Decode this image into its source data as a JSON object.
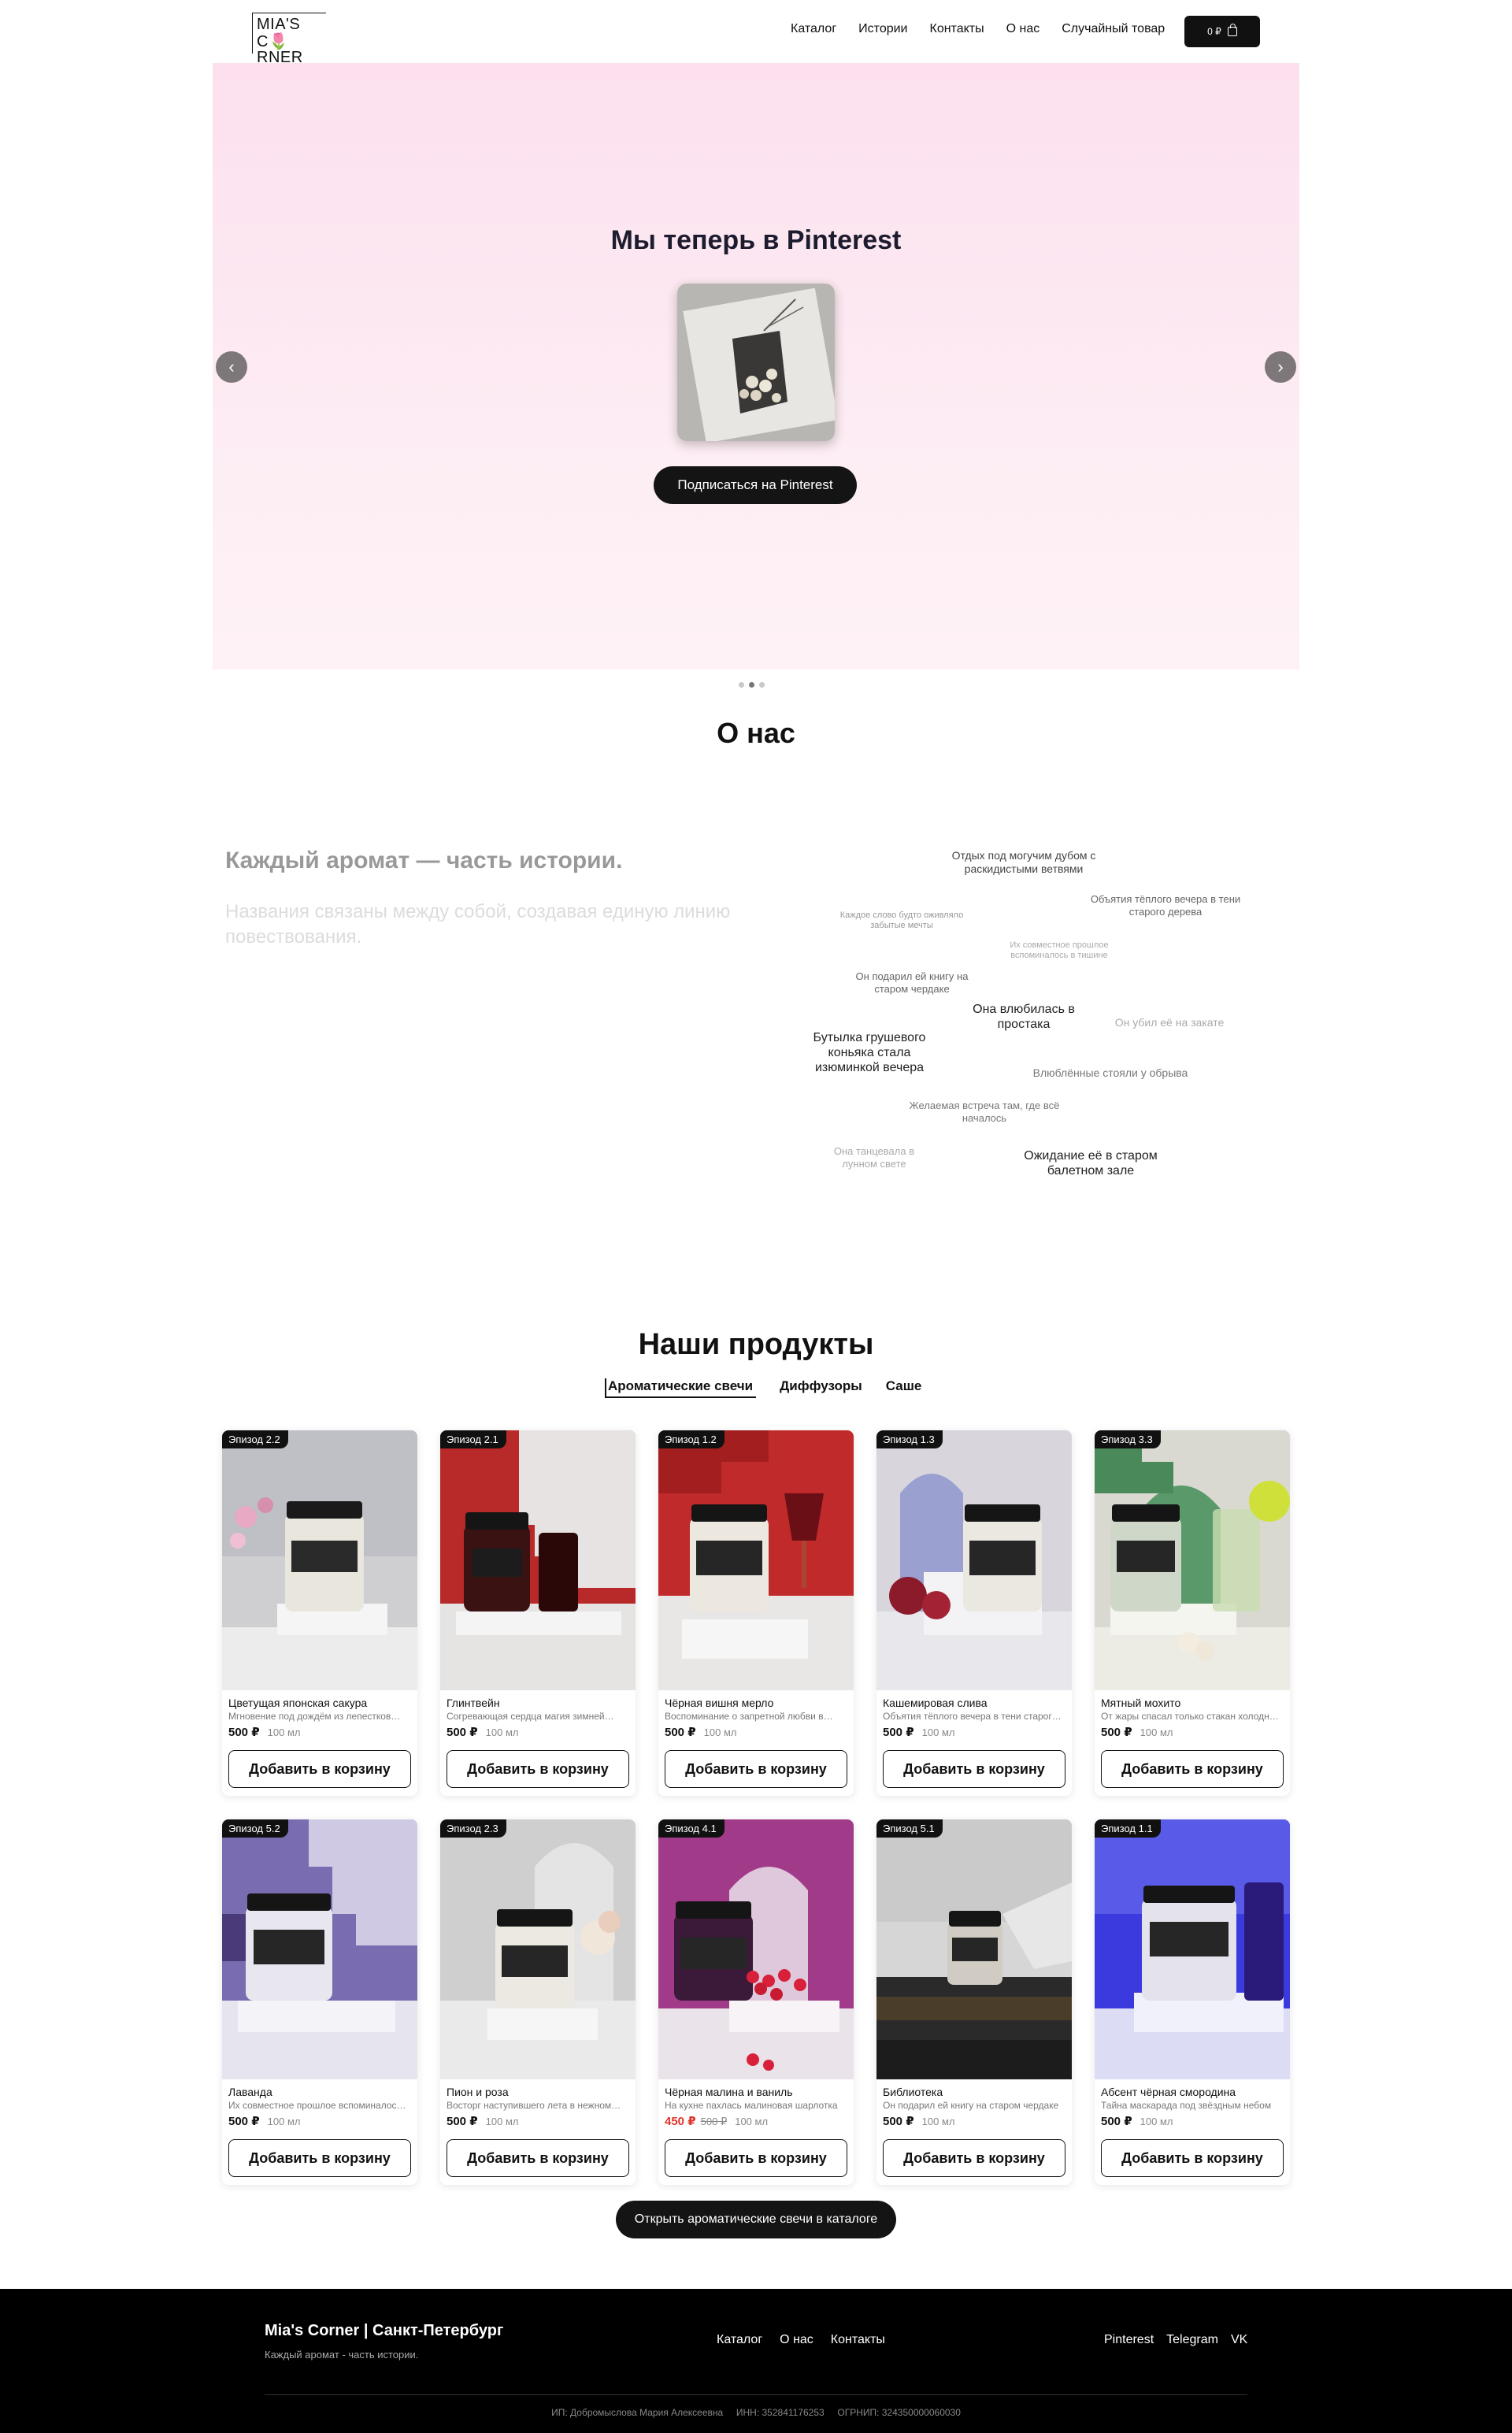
{
  "header": {
    "logo_line1": "MIA'S",
    "logo_line2": "C🌷RNER",
    "nav": [
      "Каталог",
      "Истории",
      "Контакты",
      "О нас",
      "Случайный товар"
    ],
    "cart_total": "0 ₽"
  },
  "hero": {
    "title": "Мы теперь в Pinterest",
    "cta": "Подписаться на Pinterest",
    "prev_icon": "‹",
    "next_icon": "›",
    "slides": 3,
    "active_slide": 2
  },
  "about": {
    "title": "О нас",
    "headline": "Каждый аромат — часть истории.",
    "subline": "Названия связаны между собой, создавая единую линию повествования.",
    "cloud": [
      "Отдых под могучим дубом с раскидистыми ветвями",
      "Объятия тёплого вечера в тени старого дерева",
      "Каждое слово будто оживляло забытые мечты",
      "Их совместное прошлое вспоминалось в тишине",
      "Он подарил ей книгу на старом чердаке",
      "Она влюбилась в простака",
      "Он убил её на закате",
      "Бутылка грушевого коньяка стала изюминкой вечера",
      "Влюблённые стояли у обрыва",
      "Желаемая встреча там, где всё началось",
      "Она танцевала в лунном свете",
      "Ожидание её в старом балетном зале"
    ]
  },
  "products": {
    "title": "Наши продукты",
    "tabs": [
      "Ароматические свечи",
      "Диффузоры",
      "Саше"
    ],
    "add_label": "Добавить в корзину",
    "items": [
      {
        "episode": "Эпизод 2.2",
        "name": "Цветущая японская сакура",
        "desc": "Мгновение под дождём из лепестков…",
        "price": "500 ₽",
        "old_price": "",
        "volume": "100 мл"
      },
      {
        "episode": "Эпизод 2.1",
        "name": "Глинтвейн",
        "desc": "Согревающая сердца магия зимней…",
        "price": "500 ₽",
        "old_price": "",
        "volume": "100 мл"
      },
      {
        "episode": "Эпизод 1.2",
        "name": "Чёрная вишня мерло",
        "desc": "Воспоминание о запретной любви в…",
        "price": "500 ₽",
        "old_price": "",
        "volume": "100 мл"
      },
      {
        "episode": "Эпизод 1.3",
        "name": "Кашемировая слива",
        "desc": "Объятия тёплого вечера в тени старог…",
        "price": "500 ₽",
        "old_price": "",
        "volume": "100 мл"
      },
      {
        "episode": "Эпизод 3.3",
        "name": "Мятный мохито",
        "desc": "От жары спасал только стакан холодн…",
        "price": "500 ₽",
        "old_price": "",
        "volume": "100 мл"
      },
      {
        "episode": "Эпизод 5.2",
        "name": "Лаванда",
        "desc": "Их совместное прошлое вспоминалос…",
        "price": "500 ₽",
        "old_price": "",
        "volume": "100 мл"
      },
      {
        "episode": "Эпизод 2.3",
        "name": "Пион и роза",
        "desc": "Восторг наступившего лета в нежном…",
        "price": "500 ₽",
        "old_price": "",
        "volume": "100 мл"
      },
      {
        "episode": "Эпизод 4.1",
        "name": "Чёрная малина и ваниль",
        "desc": "На кухне пахлась малиновая шарлотка",
        "price": "450 ₽",
        "old_price": "500 ₽",
        "volume": "100 мл"
      },
      {
        "episode": "Эпизод 5.1",
        "name": "Библиотека",
        "desc": "Он подарил ей книгу на старом чердаке",
        "price": "500 ₽",
        "old_price": "",
        "volume": "100 мл"
      },
      {
        "episode": "Эпизод 1.1",
        "name": "Абсент чёрная смородина",
        "desc": "Тайна маскарада под звёздным небом",
        "price": "500 ₽",
        "old_price": "",
        "volume": "100 мл"
      }
    ],
    "open_catalog": "Открыть ароматические свечи в каталоге"
  },
  "footer": {
    "brand": "Mia's Corner | Санкт-Петербург",
    "tagline": "Каждый аромат - часть истории.",
    "nav": [
      "Каталог",
      "О нас",
      "Контакты"
    ],
    "social": [
      "Pinterest",
      "Telegram",
      "VK"
    ],
    "legal": "ИП: Добромыслова Мария Алексеевна     ИНН: 352841176253     ОГРНИП: 324350000060030"
  },
  "colors": {
    "accent": "#141414",
    "sale": "#e0342a",
    "hero_bg": "#fce0ee"
  }
}
